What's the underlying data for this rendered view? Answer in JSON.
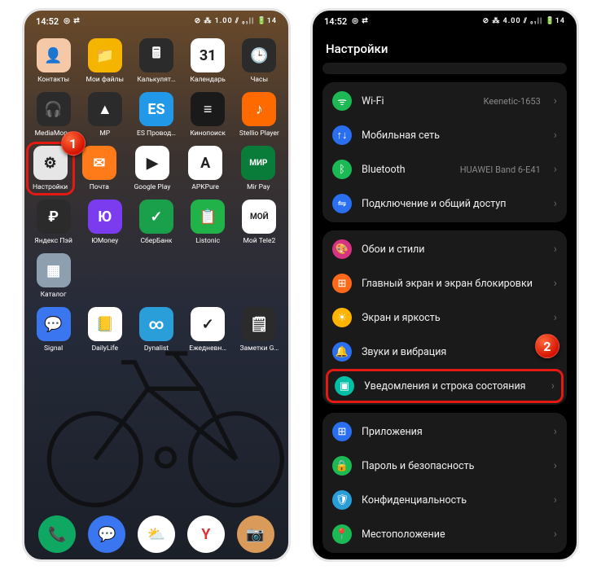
{
  "status": {
    "time": "14:52",
    "indicators": "◎ ⇄",
    "right": "⊘ ⁂ 1.00 ⫽ ₀₁|| 🔋14",
    "right2": "⊘ ⁂ 4.00 ⫽ ₀₁|| 🔋14"
  },
  "left": {
    "apps": [
      [
        {
          "label": "Контакты",
          "bg": "#f5c8a8",
          "glyph": "👤"
        },
        {
          "label": "Мои файлы",
          "bg": "#f4b400",
          "glyph": "📁"
        },
        {
          "label": "Калькулят…",
          "bg": "#2b2b2b",
          "glyph": "🖩"
        },
        {
          "label": "Календарь",
          "bg": "#fff",
          "glyph": "31"
        },
        {
          "label": "Часы",
          "bg": "#2b2b2b",
          "glyph": "🕒"
        }
      ],
      [
        {
          "label": "MediaMon…",
          "bg": "#2b2b2b",
          "glyph": "🎧"
        },
        {
          "label": "MP",
          "bg": "#2b2b2b",
          "glyph": "▲"
        },
        {
          "label": "ES Провод…",
          "bg": "#2199e8",
          "glyph": "ES"
        },
        {
          "label": "Кинопоиск",
          "bg": "#1a1a1a",
          "glyph": "≡"
        },
        {
          "label": "Stellio Player",
          "bg": "#ff6a00",
          "glyph": "♪"
        }
      ],
      [
        {
          "label": "Настройки",
          "bg": "#e6e6e6",
          "glyph": "⚙",
          "highlight": true
        },
        {
          "label": "Почта",
          "bg": "#ff7b1a",
          "glyph": "✉"
        },
        {
          "label": "Google Play",
          "bg": "#fff",
          "glyph": "▶"
        },
        {
          "label": "APKPure",
          "bg": "#fff",
          "glyph": "A"
        },
        {
          "label": "Mir Pay",
          "bg": "#0a7c3a",
          "glyph": "МИР"
        }
      ],
      [
        {
          "label": "Яндекс Пэй",
          "bg": "#2b2b2b",
          "glyph": "₽"
        },
        {
          "label": "ЮMoney",
          "bg": "#7b3cf0",
          "glyph": "Ю"
        },
        {
          "label": "СберБанк",
          "bg": "#1aa04a",
          "glyph": "✓"
        },
        {
          "label": "Listonic",
          "bg": "#21b24a",
          "glyph": "📋"
        },
        {
          "label": "Мой Tele2",
          "bg": "#fff",
          "glyph": "МОЙ"
        }
      ],
      [
        {
          "label": "Каталог",
          "bg": "#8ea0b0",
          "glyph": "▦"
        },
        null,
        null,
        null,
        null
      ],
      [
        {
          "label": "Signal",
          "bg": "#3a76f0",
          "glyph": "💬"
        },
        {
          "label": "DailyLife",
          "bg": "#fff",
          "glyph": "📒"
        },
        {
          "label": "Dynalist",
          "bg": "#2a9ed8",
          "glyph": "∞"
        },
        {
          "label": "Ежедневн…",
          "bg": "#fff",
          "glyph": "✓"
        },
        {
          "label": "Заметки G…",
          "bg": "#2b2b2b",
          "glyph": "🗒"
        }
      ]
    ],
    "dock": [
      {
        "bg": "#0ea862",
        "glyph": "📞",
        "name": "phone"
      },
      {
        "bg": "#3a76f0",
        "glyph": "💬",
        "name": "messages"
      },
      {
        "bg": "#fff",
        "glyph": "⛅",
        "name": "weather"
      },
      {
        "bg": "#fff",
        "glyph": "Y",
        "name": "yandex"
      },
      {
        "bg": "#d99a5a",
        "glyph": "📷",
        "name": "camera"
      }
    ],
    "callout": "1"
  },
  "right": {
    "title": "Настройки",
    "callout": "2",
    "groups": [
      [
        {
          "icon_bg": "#1db954",
          "glyph": "ᯤ",
          "label": "Wi-Fi",
          "value": "Keenetic-1653"
        },
        {
          "icon_bg": "#2a6ff0",
          "glyph": "↑↓",
          "label": "Мобильная сеть"
        },
        {
          "icon_bg": "#1db954",
          "glyph": "ᛒ",
          "label": "Bluetooth",
          "value": "HUAWEI Band 6-E41"
        },
        {
          "icon_bg": "#2a6ff0",
          "glyph": "⇋",
          "label": "Подключение и общий доступ"
        }
      ],
      [
        {
          "icon_bg": "#d63384",
          "glyph": "🎨",
          "label": "Обои и стили"
        },
        {
          "icon_bg": "#ff6a1a",
          "glyph": "⊞",
          "label": "Главный экран и экран блокировки"
        },
        {
          "icon_bg": "#ffb400",
          "glyph": "☀",
          "label": "Экран и яркость"
        },
        {
          "icon_bg": "#2a6ff0",
          "glyph": "🔔",
          "label": "Звуки и вибрация"
        },
        {
          "icon_bg": "#00bfa5",
          "glyph": "▣",
          "label": "Уведомления и строка состояния",
          "highlight": true
        }
      ],
      [
        {
          "icon_bg": "#2a6ff0",
          "glyph": "⊞",
          "label": "Приложения"
        },
        {
          "icon_bg": "#1db954",
          "glyph": "🔒",
          "label": "Пароль и безопасность"
        },
        {
          "icon_bg": "#2a9ed8",
          "glyph": "🛡",
          "label": "Конфиденциальность"
        },
        {
          "icon_bg": "#1db954",
          "glyph": "📍",
          "label": "Местоположение"
        }
      ]
    ]
  }
}
